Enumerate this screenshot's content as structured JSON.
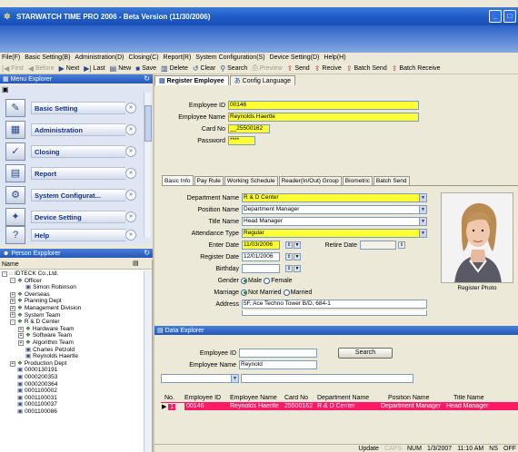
{
  "window": {
    "title": "STARWATCH TIME PRO 2006 - Beta Version (11/30/2006)",
    "controls": {
      "minimize": "_",
      "maximize": "□"
    }
  },
  "menubar": [
    "File(F)",
    "Basic Setting(B)",
    "Administration(D)",
    "Closing(C)",
    "Report(R)",
    "System Configuration(S)",
    "Device Setting(D)",
    "Help(H)"
  ],
  "toolbar": {
    "first": "First",
    "before": "Before",
    "next": "Next",
    "last": "Last",
    "new": "New",
    "save": "Save",
    "delete": "Delete",
    "clear": "Clear",
    "search": "Search",
    "preview": "Preview",
    "send": "Send",
    "receive": "Recive",
    "batch_send": "Batch Send",
    "batch_receive": "Batch Receive"
  },
  "menu_explorer": {
    "title": "Menu Explorer",
    "items": [
      {
        "label": "Basic Setting"
      },
      {
        "label": "Administration"
      },
      {
        "label": "Closing"
      },
      {
        "label": "Report"
      },
      {
        "label": "System Configurat..."
      },
      {
        "label": "Device Setting"
      },
      {
        "label": "Help"
      }
    ]
  },
  "person_explorer": {
    "title": "Person Expplorer",
    "name_header": "Name",
    "tree": [
      {
        "label": "IDTECK Co.,Ltd.",
        "indent": 0,
        "exp": "-",
        "icon": "org"
      },
      {
        "label": "Officer",
        "indent": 1,
        "exp": "-",
        "icon": "group"
      },
      {
        "label": "Simon Robinson",
        "indent": 2,
        "exp": "",
        "icon": "person"
      },
      {
        "label": "Overseas",
        "indent": 1,
        "exp": "+",
        "icon": "group"
      },
      {
        "label": "Planning Dept",
        "indent": 1,
        "exp": "+",
        "icon": "group"
      },
      {
        "label": "Management Division",
        "indent": 1,
        "exp": "+",
        "icon": "group"
      },
      {
        "label": "System Team",
        "indent": 1,
        "exp": "+",
        "icon": "group"
      },
      {
        "label": "R & D Center",
        "indent": 1,
        "exp": "-",
        "icon": "group"
      },
      {
        "label": "Hardware Team",
        "indent": 2,
        "exp": "+",
        "icon": "group"
      },
      {
        "label": "Software Team",
        "indent": 2,
        "exp": "+",
        "icon": "group"
      },
      {
        "label": "Algorithm Team",
        "indent": 2,
        "exp": "+",
        "icon": "group"
      },
      {
        "label": "Charles Petzold",
        "indent": 2,
        "exp": "",
        "icon": "person"
      },
      {
        "label": "Reynolds Haertle",
        "indent": 2,
        "exp": "",
        "icon": "person"
      },
      {
        "label": "Production Dept",
        "indent": 1,
        "exp": "+",
        "icon": "group"
      },
      {
        "label": "0000130191",
        "indent": 1,
        "exp": "",
        "icon": "person"
      },
      {
        "label": "0000200353",
        "indent": 1,
        "exp": "",
        "icon": "person"
      },
      {
        "label": "0000200364",
        "indent": 1,
        "exp": "",
        "icon": "person"
      },
      {
        "label": "0001100002",
        "indent": 1,
        "exp": "",
        "icon": "person"
      },
      {
        "label": "0001100031",
        "indent": 1,
        "exp": "",
        "icon": "person"
      },
      {
        "label": "0001100037",
        "indent": 1,
        "exp": "",
        "icon": "person"
      },
      {
        "label": "0001100086",
        "indent": 1,
        "exp": "",
        "icon": "person"
      }
    ]
  },
  "tabs": {
    "register": "Register Employee",
    "config": "Config Language"
  },
  "employee": {
    "id_label": "Employee ID",
    "id": "00146",
    "name_label": "Employee Name",
    "name": "Reynolds Haertle",
    "card_label": "Card No",
    "card": "__25500162",
    "password_label": "Password",
    "password": "****"
  },
  "subtabs": [
    "Basic Info",
    "Pay Rule",
    "Working Schedule",
    "Reader(In/Out) Group",
    "Biometric",
    "Batch Send"
  ],
  "basic_info": {
    "department_label": "Department Name",
    "department": "R & D Center",
    "position_label": "Position Name",
    "position": "Department Manager",
    "title_label": "Title Name",
    "title": "Head Manager",
    "attendance_label": "Attendance Type",
    "attendance": "Regular",
    "enter_date_label": "Enter Date",
    "enter_date": "11/03/2006",
    "retire_date_label": "Retire Date",
    "register_date_label": "Register Date",
    "register_date": "12/01/2006",
    "birthday_label": "Birthday",
    "gender_label": "Gender",
    "gender_male": "Male",
    "gender_female": "Female",
    "marriage_label": "Marriage",
    "marriage_no": "Not Married",
    "marriage_yes": "Married",
    "address_label": "Address",
    "address": "5F, Ace Techno Tower B/D, 684-1",
    "photo_label": "Register Photo"
  },
  "data_explorer": {
    "title": "Data Explorer",
    "id_label": "Employee ID",
    "name_label": "Employee Name",
    "name_value": "Reynold",
    "search_button": "Search",
    "columns": [
      "No.",
      "Employee ID",
      "Employee Name",
      "Card No",
      "Department Name",
      "Position Name",
      "Title Name"
    ],
    "rows": [
      [
        "1",
        "00146",
        "Reynolds Haertle",
        "25500162",
        "R & D Center",
        "Department Manager",
        "Head Manager"
      ]
    ]
  },
  "statusbar": {
    "update": "Update",
    "caps": "CAPS",
    "num": "NUM",
    "date": "1/3/2007",
    "time": "11:10 AM",
    "ns": "NS",
    "off": "OFF"
  },
  "colors": {
    "highlight": "#ffff33",
    "selected_row": "#ff1a66",
    "titlebar": "#1f5cc8"
  }
}
